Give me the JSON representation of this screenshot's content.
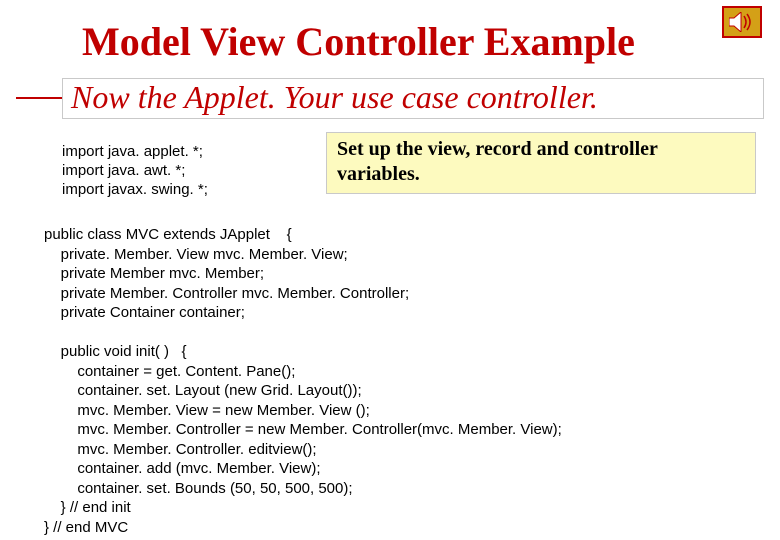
{
  "icon": {
    "name": "speaker-icon"
  },
  "title": "Model View Controller Example",
  "subtitle": "Now the Applet. Your use case controller.",
  "imports": "import java. applet. *;\nimport java. awt. *;\nimport javax. swing. *;",
  "callout": "Set up the view, record and controller variables.",
  "code": "public class MVC extends JApplet    {\n    private. Member. View mvc. Member. View;\n    private Member mvc. Member;\n    private Member. Controller mvc. Member. Controller;\n    private Container container;\n\n    public void init( )   {\n        container = get. Content. Pane();\n        container. set. Layout (new Grid. Layout());\n        mvc. Member. View = new Member. View ();\n        mvc. Member. Controller = new Member. Controller(mvc. Member. View);\n        mvc. Member. Controller. editview();\n        container. add (mvc. Member. View);\n        container. set. Bounds (50, 50, 500, 500);\n    } // end init\n} // end MVC"
}
